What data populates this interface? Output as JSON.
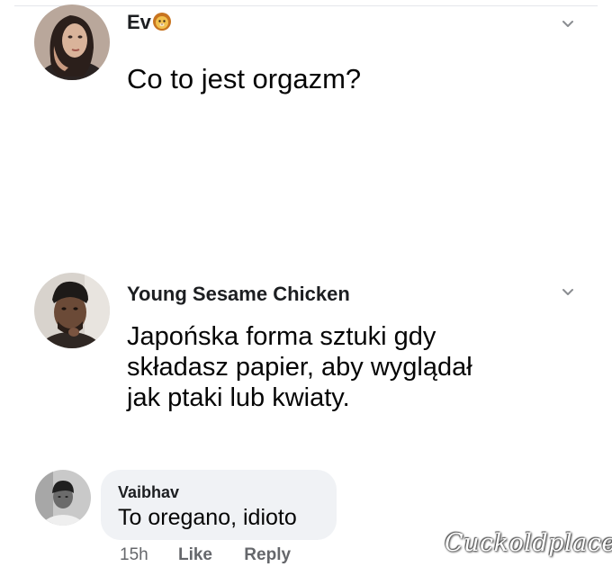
{
  "post1": {
    "author": "Ev",
    "author_emoji": "lion-emoji",
    "text": "Co to jest orgazm?"
  },
  "post2": {
    "author": "Young Sesame Chicken",
    "text_lines": [
      "Japońska forma sztuki gdy",
      "składasz papier, aby wyglądał",
      "jak ptaki lub kwiaty."
    ]
  },
  "comment": {
    "author": "Vaibhav",
    "text": "To oregano, idioto",
    "time": "15h",
    "like_label": "Like",
    "reply_label": "Reply"
  },
  "watermark": "Cuckoldplace",
  "icons": {
    "menu": "chevron-down-icon",
    "emoji": "lion-face-icon"
  },
  "colors": {
    "bubble": "#f0f2f5",
    "secondary_text": "#65676b",
    "primary_text": "#1c1e21"
  }
}
